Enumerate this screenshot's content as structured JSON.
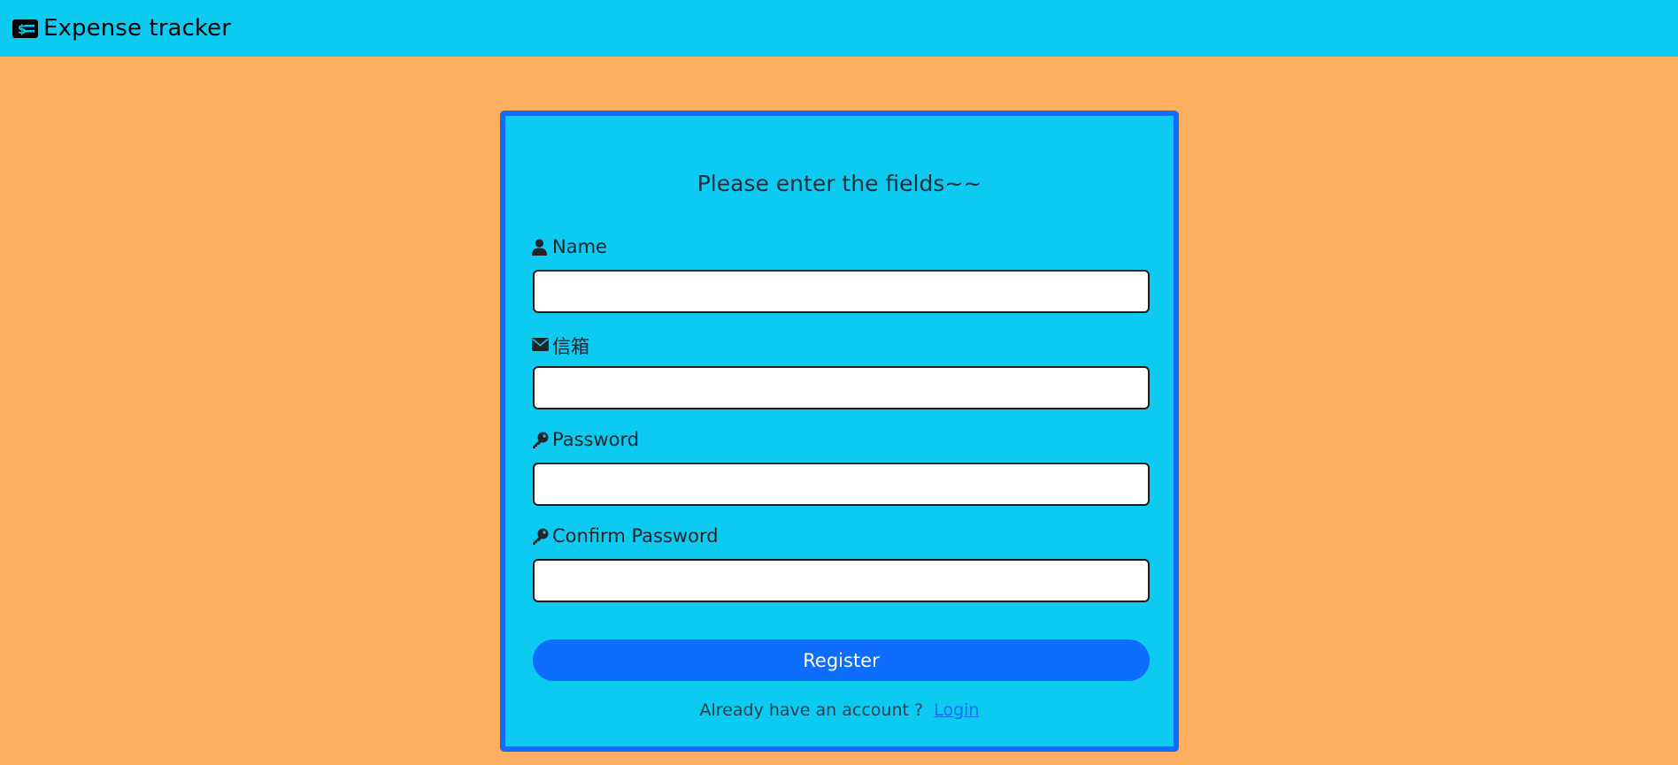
{
  "app": {
    "title": "Expense tracker",
    "brand_icon": "money-check-dollar-icon"
  },
  "colors": {
    "navbar_bg": "#0dcaf0",
    "page_bg": "#feae60",
    "card_bg": "#0dcaf0",
    "card_border": "#0d6efd",
    "button_bg": "#0d6efd",
    "link": "#0d6efd"
  },
  "form": {
    "heading": "Please enter the fields~~",
    "fields": [
      {
        "label": "Name",
        "icon": "user-icon",
        "value": "",
        "placeholder": ""
      },
      {
        "label": "信箱",
        "icon": "envelope-icon",
        "value": "",
        "placeholder": ""
      },
      {
        "label": "Password",
        "icon": "key-icon",
        "value": "",
        "placeholder": ""
      },
      {
        "label": "Confirm Password",
        "icon": "key-icon",
        "value": "",
        "placeholder": ""
      }
    ],
    "submit_label": "Register",
    "footer_text": "Already have an account ?",
    "footer_link": "Login"
  }
}
